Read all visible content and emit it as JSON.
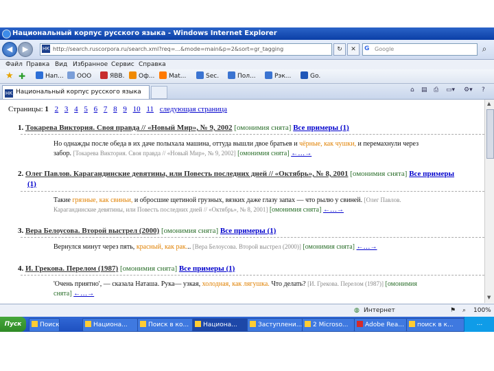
{
  "window": {
    "title": "Национальный корпус русского языка - Windows Internet Explorer",
    "address": "http://search.ruscorpora.ru/search.xml?req=...&mode=main&p=2&sort=gr_tagging",
    "search_placeholder": "Google"
  },
  "menu": [
    "Файл",
    "Правка",
    "Вид",
    "Избранное",
    "Сервис",
    "Справка"
  ],
  "favorites": [
    "Нап...",
    "ООО",
    "ЯВВ.",
    "Оф...",
    "Mat...",
    "Sec.",
    "Пол...",
    "Рэк...",
    "Go."
  ],
  "tab": {
    "label": "Национальный корпус русского языка"
  },
  "pager": {
    "label": "Страницы:",
    "current": "1",
    "pages": [
      "2",
      "3",
      "4",
      "5",
      "6",
      "7",
      "8",
      "9",
      "10",
      "11"
    ],
    "next": "следующая страница"
  },
  "results": [
    {
      "num": "1.",
      "title": "Токарева Виктория. Своя правда // «Новый Мир», № 9, 2002",
      "omonymy": "[омонимия снята]",
      "all": "Все примеры (1)",
      "ex_pre": "Но однажды после обеда в их даче полыхала машина, оттуда вышли двое братьев и",
      "kw": "чёрные, как чушки,",
      "ex_post": "и перемахнули через",
      "ex_line2": "забор.",
      "src": "[Токарева Виктория. Своя правда // «Новый Мир», № 9, 2002]",
      "omonymy2": "[омонимия снята]",
      "arrow": "←…→"
    },
    {
      "num": "2.",
      "title": "Олег Павлов. Карагандинские девятины, или Повесть последних дней // «Октябрь», № 8, 2001",
      "omonymy": "[омонимия снята]",
      "all": "Все примеры",
      "all_cont": "(1)",
      "ex_pre": "Такие",
      "kw": "грязные, как свиньи,",
      "ex_post": "и обросшие щетиной грузных, вязких даже глазу запах — что рылю у свиней.",
      "src_a": "[Олег Павлов.",
      "src_b": "Карагандинские девятины, или Повесть последних дней // «Октябрь», № 8, 2001]",
      "omonymy2": "[омонимия снята]",
      "arrow": "←…→"
    },
    {
      "num": "3.",
      "title": "Вера Белоусова. Второй выстрел (2000)",
      "omonymy": "[омонимия снята]",
      "all": "Все примеры (1)",
      "ex_pre": "Вернулся минут через пять,",
      "kw": "красный, как рак.",
      "ex_post": "..",
      "src": "[Вера Белоусова. Второй выстрел (2000)]",
      "omonymy2": "[омонимия снята]",
      "arrow": "←…→"
    },
    {
      "num": "4.",
      "title": "И. Грекова. Перелом (1987)",
      "omonymy": "[омонимия снята]",
      "all": "Все примеры (1)",
      "ex_pre": "'Очень приятно', — сказала Наташа. Рука— узкая,",
      "kw": "холодная, как лягушка.",
      "ex_post": "Что делать?",
      "src": "[И. Грекова. Перелом (1987)]",
      "omonymy2_a": "[омонимия",
      "omonymy2_b": "снята]",
      "arrow": "←…→"
    }
  ],
  "status": {
    "zone": "Интернет",
    "zoom": "100%"
  },
  "taskbar": {
    "start": "Пуск",
    "items": [
      "Поиск в ...",
      "Национа...",
      "Поиск в ко...",
      "Национа...",
      "Заступлени...",
      "2 Microso...",
      "Adobe Rea...",
      "поиск в к..."
    ],
    "clock": "..."
  },
  "colors": {
    "keyword": "#e08000",
    "link": "#0000cc",
    "omonymy": "#2a6e2a",
    "title_bar": "#0b3fa6"
  }
}
